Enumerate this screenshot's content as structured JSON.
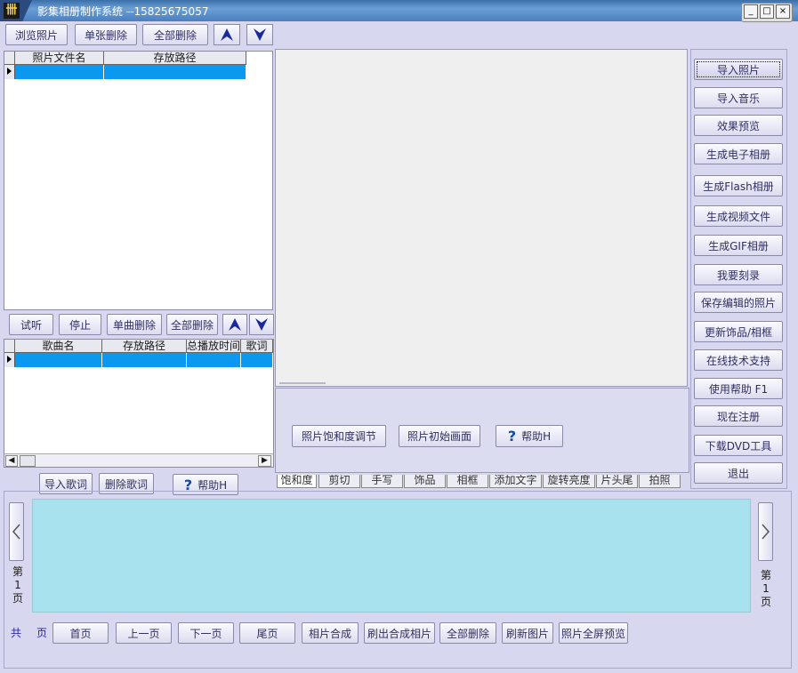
{
  "window": {
    "title": "影集相册制作系统  --15825675057"
  },
  "photo_toolbar": {
    "browse": "浏览照片",
    "delete_one": "单张删除",
    "delete_all": "全部删除"
  },
  "photo_table": {
    "columns": [
      "照片文件名",
      "存放路径"
    ]
  },
  "music_toolbar": {
    "listen": "试听",
    "stop": "停止",
    "delete_one": "单曲删除",
    "delete_all": "全部删除"
  },
  "music_table": {
    "columns": [
      "歌曲名",
      "存放路径",
      "总播放时间",
      "歌词"
    ]
  },
  "lyrics_buttons": {
    "import": "导入歌词",
    "delete": "删除歌词",
    "help": "帮助H"
  },
  "saturation_panel": {
    "adjust": "照片饱和度调节",
    "initial": "照片初始画面",
    "help": "帮助H"
  },
  "tabs": [
    "饱和度",
    "剪切",
    "手写",
    "饰品",
    "相框",
    "添加文字",
    "旋转亮度",
    "片头尾",
    "拍照"
  ],
  "right_menu": [
    "导入照片",
    "导入音乐",
    "效果预览",
    "生成电子相册",
    "生成Flash相册",
    "生成视频文件",
    "生成GIF相册",
    "我要刻录",
    "保存编辑的照片",
    "更新饰品/相框",
    "在线技术支持",
    "使用帮助  F1",
    "现在注册",
    "下载DVD工具",
    "退出"
  ],
  "pager": {
    "left_page": [
      "第",
      "1",
      "页"
    ],
    "right_page": [
      "第",
      "1",
      "页"
    ],
    "total_label": "共",
    "pages_label": "页",
    "first": "首页",
    "prev": "上一页",
    "next": "下一页",
    "last": "尾页",
    "compose": "相片合成",
    "brush_out": "刷出合成相片",
    "delete_all": "全部删除",
    "refresh": "刷新图片",
    "fullscreen": "照片全屏预览"
  },
  "colors": {
    "titlebar": "#4a7fc0",
    "selection": "#0a99ee",
    "thumb_strip": "#a8e2ee",
    "background": "#d7d7ef",
    "arrow": "#1a2a9a"
  }
}
